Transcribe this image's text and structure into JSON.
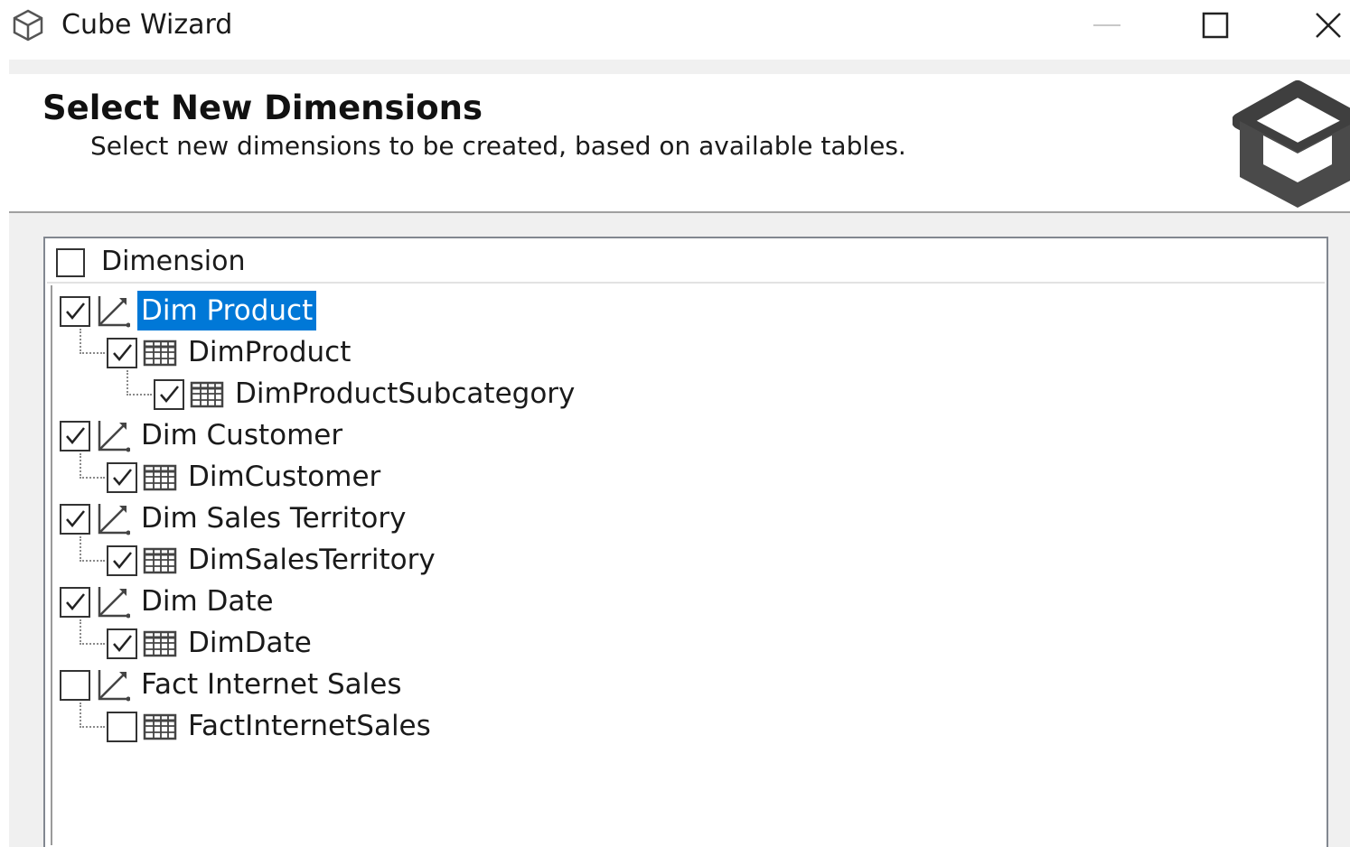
{
  "window": {
    "title": "Cube Wizard",
    "minimize_label": "—",
    "maximize_icon": "maximize-icon",
    "close_icon": "close-icon"
  },
  "header": {
    "title": "Select New Dimensions",
    "subtitle": "Select new dimensions to be created, based on available tables."
  },
  "tree": {
    "column_header": "Dimension",
    "header_checked": false,
    "items": [
      {
        "label": "Dim Product",
        "checked": true,
        "selected": true,
        "type": "dimension",
        "children": [
          {
            "label": "DimProduct",
            "checked": true,
            "type": "table",
            "children": [
              {
                "label": "DimProductSubcategory",
                "checked": true,
                "type": "table"
              }
            ]
          }
        ]
      },
      {
        "label": "Dim Customer",
        "checked": true,
        "type": "dimension",
        "children": [
          {
            "label": "DimCustomer",
            "checked": true,
            "type": "table"
          }
        ]
      },
      {
        "label": "Dim Sales Territory",
        "checked": true,
        "type": "dimension",
        "children": [
          {
            "label": "DimSalesTerritory",
            "checked": true,
            "type": "table"
          }
        ]
      },
      {
        "label": "Dim Date",
        "checked": true,
        "type": "dimension",
        "children": [
          {
            "label": "DimDate",
            "checked": true,
            "type": "table"
          }
        ]
      },
      {
        "label": "Fact Internet Sales",
        "checked": false,
        "type": "dimension",
        "children": [
          {
            "label": "FactInternetSales",
            "checked": false,
            "type": "table"
          }
        ]
      }
    ]
  },
  "colors": {
    "selection": "#0078d7",
    "border": "#828790",
    "panel_bg": "#f0f0f0"
  }
}
